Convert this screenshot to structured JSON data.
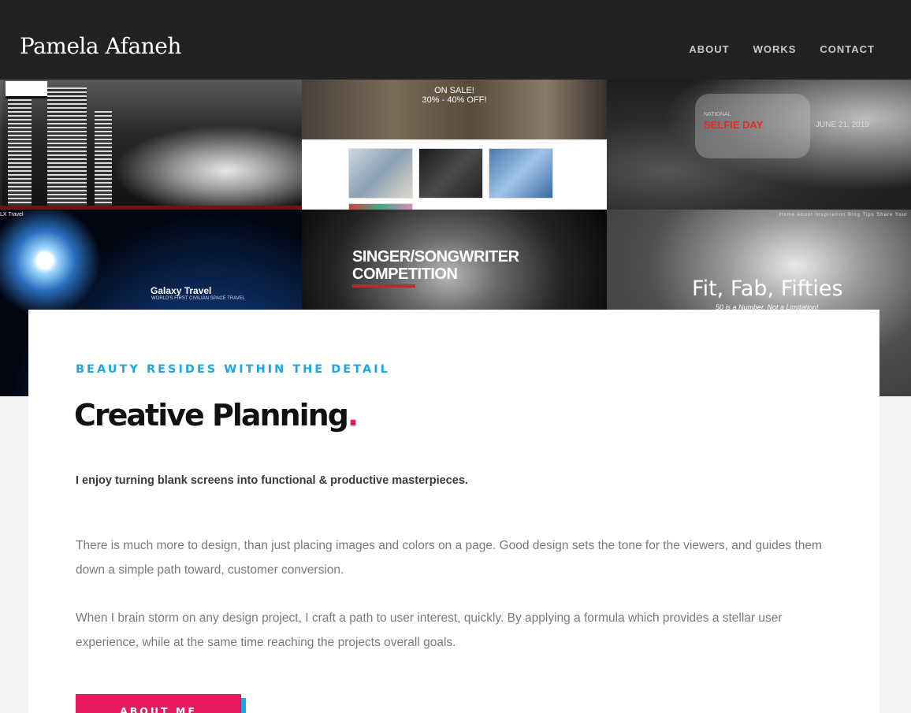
{
  "header": {
    "logo": "Pamela Afaneh",
    "nav": [
      "ABOUT",
      "WORKS",
      "CONTACT"
    ]
  },
  "mosaic": {
    "store_sale_line1": "ON SALE!",
    "store_sale_line2": "30% - 40% OFF!",
    "selfie_national": "NATIONAL",
    "selfie_title": "SELFIE DAY",
    "selfie_date": "JUNE 21, 2019",
    "galaxy_label": "LX Travel",
    "galaxy_title": "Galaxy Travel",
    "galaxy_sub": "WORLD'S FIRST CIVILIAN SPACE TRAVEL",
    "singer_line1": "SINGER/SONGWRITER",
    "singer_line2": "COMPETITION",
    "fit_menu": "Home About Inspiration Blog Tips Share Your",
    "fit_title": "Fit, Fab, Fifties",
    "fit_sub": "50 is a Number, Not a Limitation!"
  },
  "card": {
    "eyebrow": "BEAUTY RESIDES WITHIN THE DETAIL",
    "headline": "Creative Planning",
    "headline_dot": ".",
    "lead": "I enjoy turning blank screens into functional & productive masterpieces.",
    "paragraph1": "There is much more to design, than just placing images and colors on a page.  Good design sets the tone for the viewers, and guides them down a simple path toward, customer conversion.",
    "paragraph2": "When I brain storm on any design project, I craft a path to user interest, quickly.  By applying a formula which provides a stellar user experience, while at the same time reaching the projects overall goals.",
    "button": "ABOUT ME"
  },
  "colors": {
    "header_bg": "#222222",
    "accent_blue": "#1aa7e8",
    "accent_pink": "#e8195f"
  }
}
